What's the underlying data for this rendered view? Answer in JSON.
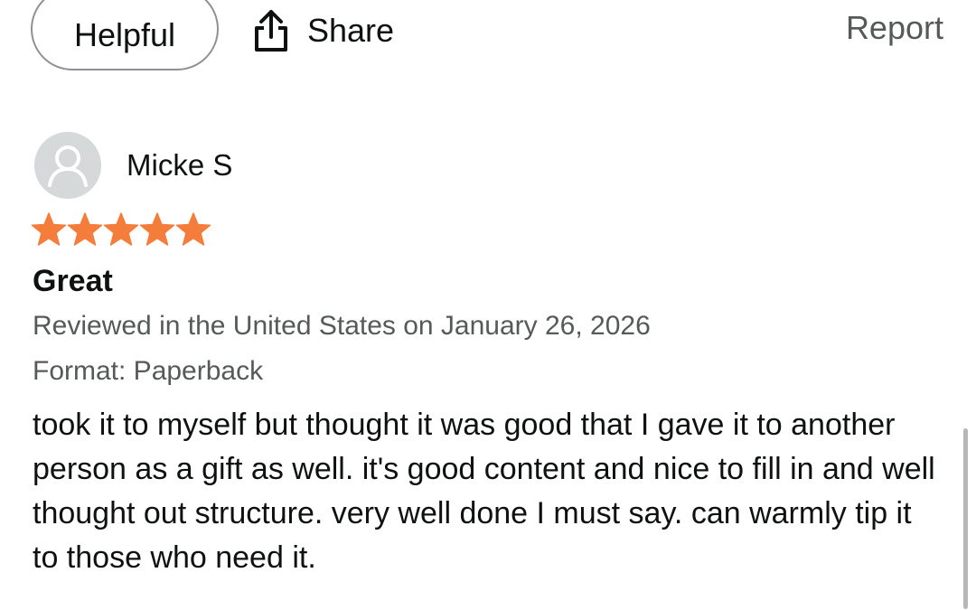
{
  "actions": {
    "helpful_label": "Helpful",
    "share_label": "Share",
    "report_label": "Report"
  },
  "review": {
    "reviewer_name": "Micke S",
    "rating": 5,
    "rating_max": 5,
    "star_color": "#f47d3b",
    "title": "Great",
    "meta": "Reviewed in the United States on January 26, 2026",
    "format": "Format: Paperback",
    "body": "took it to myself but thought it was good that I gave it to another person as a gift as well. it's good content and nice to fill in and well thought out structure. very well done I must say. can warmly tip it to those who need it."
  },
  "icons": {
    "share": "share-icon",
    "avatar": "user-avatar-icon",
    "star": "star-icon"
  }
}
